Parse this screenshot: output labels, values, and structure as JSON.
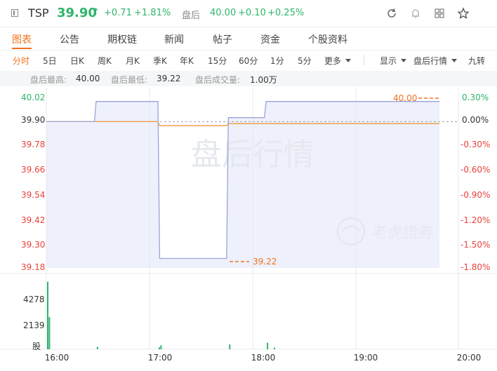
{
  "header": {
    "ticker": "TSP",
    "price": "39.90",
    "arrow": "↑",
    "change": "+0.71",
    "change_pct": "+1.81%",
    "after_hours_label": "盘后",
    "after_hours_price": "40.00",
    "after_hours_change": "+0.10",
    "after_hours_change_pct": "+0.25%",
    "up_color": "#2eb56a"
  },
  "tabs": [
    "图表",
    "公告",
    "期权链",
    "新闻",
    "帖子",
    "资金",
    "个股资料"
  ],
  "periods": [
    "分时",
    "5日",
    "日K",
    "周K",
    "月K",
    "季K",
    "年K",
    "15分",
    "60分",
    "1分",
    "5分",
    "更多"
  ],
  "options": [
    "显示",
    "盘后行情",
    "九转"
  ],
  "stats": {
    "high_label": "盘后最高:",
    "high": "40.00",
    "low_label": "盘后最低:",
    "low": "39.22",
    "volume_label": "盘后成交量:",
    "volume": "1.00万"
  },
  "chart": {
    "watermark": "盘后行情",
    "brand": "老虎證券",
    "high_marker": "40.00",
    "low_marker": "39.22",
    "left_ticks": [
      "40.02",
      "39.90",
      "39.78",
      "39.66",
      "39.54",
      "39.42",
      "39.30",
      "39.18"
    ],
    "right_ticks": [
      "0.30%",
      "0.00%",
      "-0.30%",
      "-0.60%",
      "-0.90%",
      "-1.20%",
      "-1.50%",
      "-1.80%"
    ],
    "volume_ticks": [
      "4278",
      "2139",
      "股"
    ],
    "time_ticks": [
      "16:00",
      "17:00",
      "18:00",
      "19:00",
      "20:00"
    ]
  },
  "chart_data": {
    "type": "line",
    "x": [
      "16:00",
      "16:28",
      "16:29",
      "16:40",
      "17:00",
      "17:05",
      "17:06",
      "17:45",
      "17:46",
      "18:00",
      "18:07",
      "18:08",
      "18:30",
      "19:00",
      "19:30",
      "19:49"
    ],
    "series": [
      {
        "values": [
          39.9,
          39.9,
          40.0,
          40.0,
          40.0,
          40.0,
          39.22,
          39.22,
          39.92,
          39.92,
          39.92,
          40.0,
          40.0,
          40.0,
          40.0,
          40.0
        ]
      },
      {
        "values": [
          39.9,
          39.9,
          39.9,
          39.9,
          39.9,
          39.9,
          39.88,
          39.88,
          39.89,
          39.89,
          39.89,
          39.89,
          39.89,
          39.89,
          39.89,
          39.89
        ]
      }
    ],
    "volume": {
      "x": [
        "16:00",
        "16:01",
        "16:29",
        "17:05",
        "17:06",
        "17:46",
        "18:08",
        "18:12"
      ],
      "values": [
        4200,
        2000,
        150,
        120,
        250,
        300,
        400,
        100
      ]
    },
    "ylim": [
      39.18,
      40.02
    ],
    "volume_ylim": [
      0,
      4278
    ],
    "prev_close": 39.9
  }
}
